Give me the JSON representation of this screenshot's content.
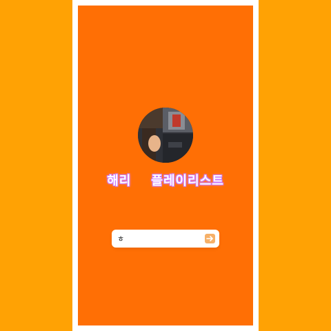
{
  "app": {
    "title": "해리    플레이리스트"
  },
  "profile": {
    "avatar_icon": "profile-photo"
  },
  "search": {
    "value": "ㅎ",
    "placeholder": "",
    "submit_icon": "arrow-right-icon"
  },
  "colors": {
    "background": "#FFA204",
    "screen": "#FF6F05",
    "frame": "#FFFFFF",
    "title_glow": "#C97BFF",
    "submit_button": "#F6B068"
  }
}
